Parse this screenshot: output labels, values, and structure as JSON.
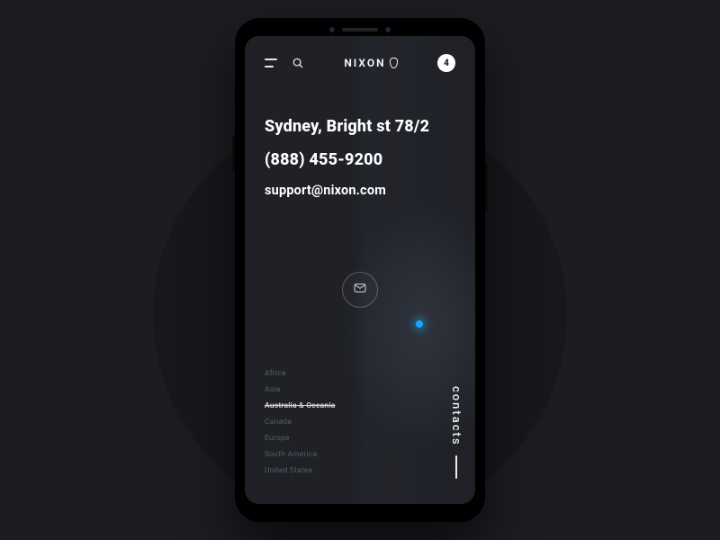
{
  "header": {
    "brand": "NIXON",
    "cart_count": "4"
  },
  "contact": {
    "address": "Sydney, Bright st 78/2",
    "phone": "(888) 455-9200",
    "email": "support@nixon.com"
  },
  "regions": [
    {
      "label": "Africa",
      "active": false
    },
    {
      "label": "Asia",
      "active": false
    },
    {
      "label": "Australia & Oceania",
      "active": true
    },
    {
      "label": "Canada",
      "active": false
    },
    {
      "label": "Europe",
      "active": false
    },
    {
      "label": "South America",
      "active": false
    },
    {
      "label": "United States",
      "active": false
    }
  ],
  "side_label": "contacts",
  "colors": {
    "accent": "#1aa6ff",
    "bg": "#1b1d22",
    "screen": "#1f2127"
  }
}
